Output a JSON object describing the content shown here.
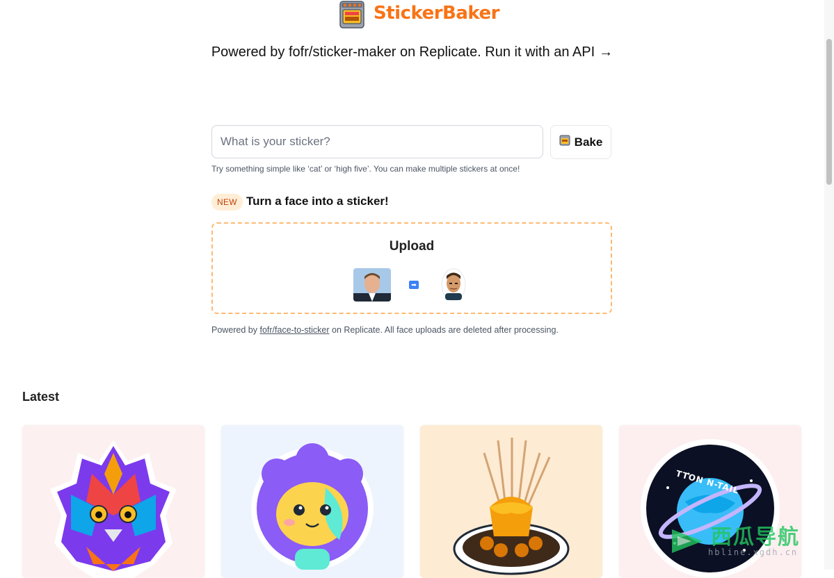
{
  "header": {
    "brand": "StickerBaker",
    "logo_icon": "oven-icon",
    "brand_color": "#f97316"
  },
  "powered_by": {
    "text": "Powered by fofr/sticker-maker on Replicate. Run it with an API",
    "arrow": "→"
  },
  "prompt": {
    "placeholder": "What is your sticker?",
    "value": "",
    "bake_label": "Bake",
    "bake_icon": "oven-icon",
    "hint": "Try something simple like ‘cat’ or ‘high five’. You can make multiple stickers at once!"
  },
  "face": {
    "badge": "NEW",
    "title": "Turn a face into a sticker!",
    "upload_label": "Upload",
    "example_photo_icon": "face-photo-icon",
    "arrow_icon": "right-arrow-icon",
    "example_sticker_icon": "face-sticker-icon",
    "footnote_prefix": "Powered by ",
    "footnote_link": "fofr/face-to-sticker",
    "footnote_suffix": " on Replicate. All face uploads are deleted after processing."
  },
  "latest": {
    "heading": "Latest",
    "items": [
      {
        "icon": "fiery-owl-sticker",
        "background": "#fdf0f0"
      },
      {
        "icon": "purple-monster-sticker",
        "background": "#eef4fd"
      },
      {
        "icon": "dessert-sticker",
        "background": "#fdebd3"
      },
      {
        "icon": "planet-badge-sticker",
        "background": "#fdeff0",
        "badge_text": "TTON N-TAIL"
      }
    ]
  },
  "watermark": {
    "text": "西瓜导航",
    "url": "hbline.xgdh.cn"
  },
  "colors": {
    "accent": "#f97316",
    "badge_bg": "#ffedd5",
    "upload_border": "#fdba74"
  }
}
